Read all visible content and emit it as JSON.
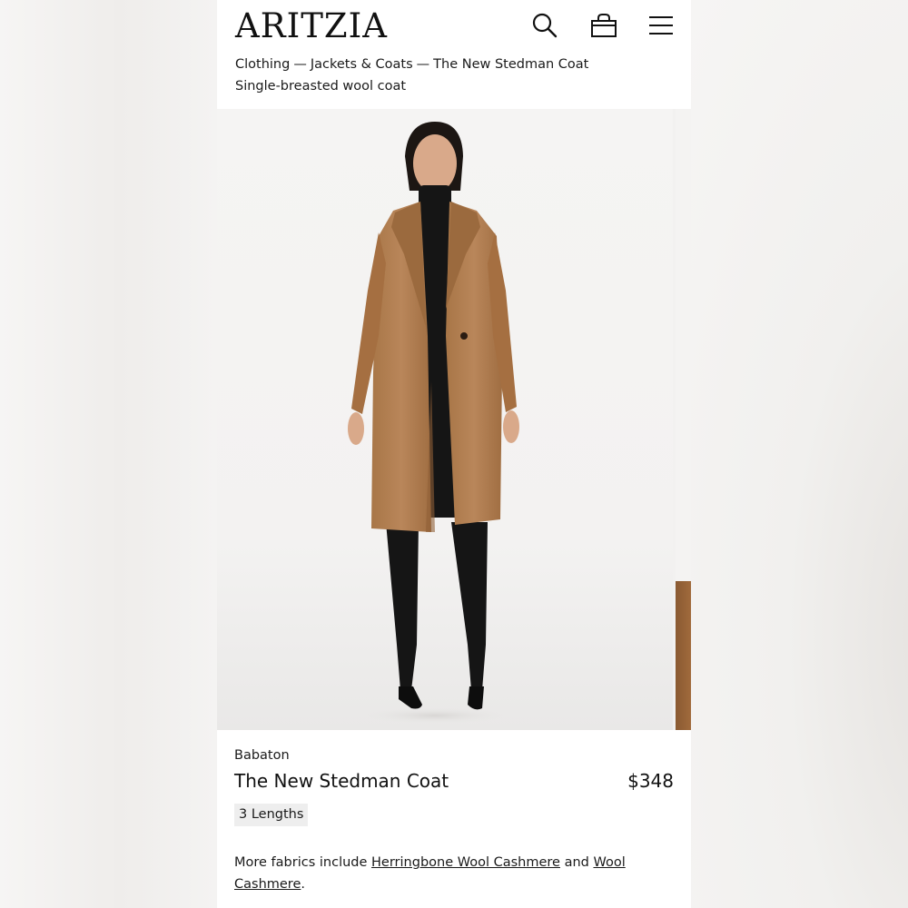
{
  "header": {
    "logo": "ARITZIA",
    "search_icon": "search-icon",
    "bag_icon": "shopping-bag-icon",
    "menu_icon": "hamburger-menu-icon"
  },
  "breadcrumb": {
    "items": [
      "Clothing",
      "Jackets & Coats",
      "The New Stedman Coat"
    ],
    "separator": "—"
  },
  "subtitle": "Single-breasted wool coat",
  "product": {
    "brand": "Babaton",
    "name": "The New Stedman Coat",
    "price": "$348",
    "lengths_badge": "3 Lengths",
    "fabrics_prefix": "More fabrics include ",
    "fabric_link_1": "Herringbone Wool Cashmere",
    "fabrics_middle": " and ",
    "fabric_link_2": "Wool Cashmere",
    "fabrics_suffix": "."
  },
  "colors": {
    "coat": "#b07c4f",
    "coat_shadow": "#8f5f37",
    "outfit": "#151515",
    "skin": "#d9a98a",
    "hair": "#1c1613"
  }
}
